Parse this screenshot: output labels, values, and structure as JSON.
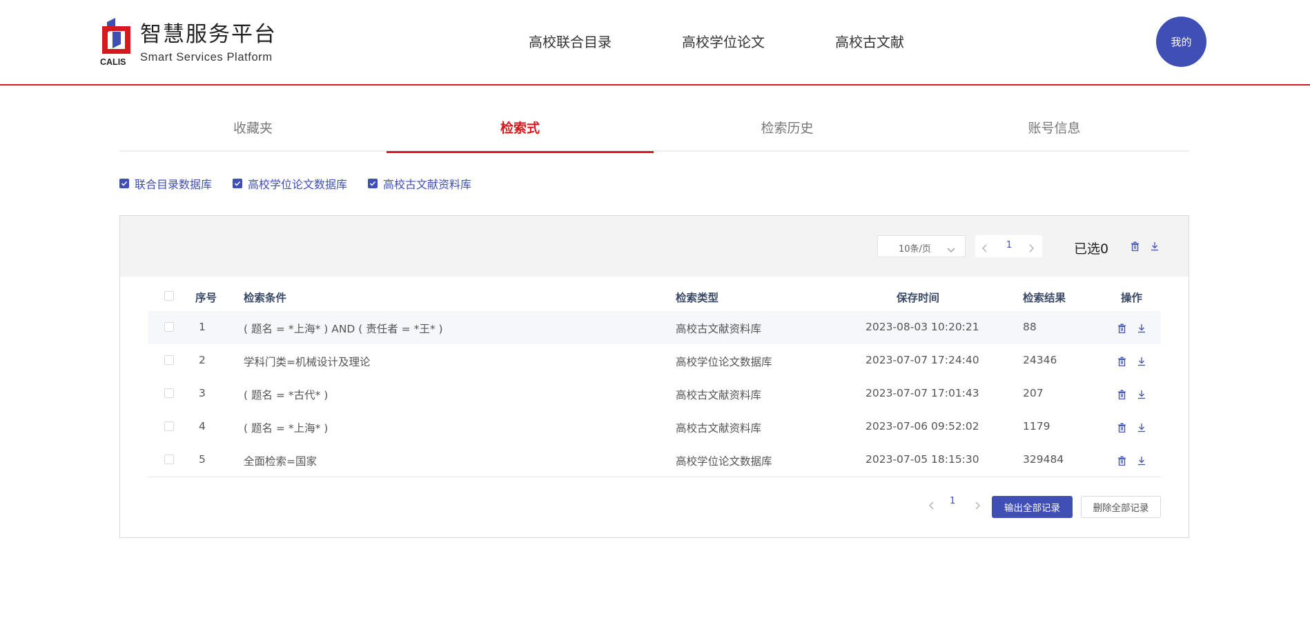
{
  "brand": {
    "title": "智慧服务平台",
    "subtitle": "Smart Services Platform",
    "logo_text": "CALIS",
    "accent_red": "#d7191f",
    "accent_blue": "#3f4fb5"
  },
  "nav": {
    "items": [
      "高校联合目录",
      "高校学位论文",
      "高校古文献"
    ],
    "avatar_label": "我的"
  },
  "tabs": {
    "items": [
      "收藏夹",
      "检索式",
      "检索历史",
      "账号信息"
    ],
    "active": "检索式"
  },
  "filters": [
    {
      "label": "联合目录数据库",
      "checked": true
    },
    {
      "label": "高校学位论文数据库",
      "checked": true
    },
    {
      "label": "高校古文献资料库",
      "checked": true
    }
  ],
  "toolbar": {
    "page_size": "10条/页",
    "page": "1",
    "selected": "已选0",
    "icons": [
      "trash-icon",
      "download-icon"
    ]
  },
  "table": {
    "columns": [
      "序号",
      "检索条件",
      "检索类型",
      "保存时间",
      "检索结果",
      "操作"
    ],
    "rows": [
      {
        "index": "1",
        "condition": "( 题名 = *上海* ) AND ( 责任者 = *王* )",
        "type": "高校古文献资料库",
        "time": "2023-08-03 10:20:21",
        "result": "88"
      },
      {
        "index": "2",
        "condition": "学科门类=机械设计及理论",
        "type": "高校学位论文数据库",
        "time": "2023-07-07 17:24:40",
        "result": "24346"
      },
      {
        "index": "3",
        "condition": "( 题名 = *古代* )",
        "type": "高校古文献资料库",
        "time": "2023-07-07 17:01:43",
        "result": "207"
      },
      {
        "index": "4",
        "condition": "( 题名 = *上海* )",
        "type": "高校古文献资料库",
        "time": "2023-07-06 09:52:02",
        "result": "1179"
      },
      {
        "index": "5",
        "condition": "全面检索=国家",
        "type": "高校学位论文数据库",
        "time": "2023-07-05 18:15:30",
        "result": "329484"
      }
    ]
  },
  "footer": {
    "page": "1",
    "export_all": "输出全部记录",
    "delete_all": "删除全部记录"
  }
}
